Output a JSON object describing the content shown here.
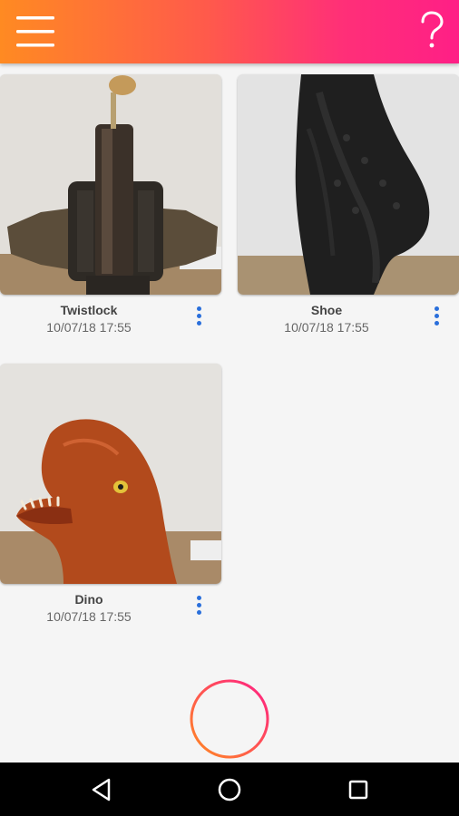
{
  "app": {
    "icons": {
      "menu": "hamburger-menu-icon",
      "help": "question-mark-icon",
      "add": "plus-icon",
      "more": "more-vertical-icon"
    },
    "colors": {
      "appbar_gradient_start": "#ff8a22",
      "appbar_gradient_end": "#ff1f86",
      "accent_blue": "#2a6fdb",
      "background": "#f5f5f5"
    }
  },
  "captures": [
    {
      "title": "Twistlock",
      "date": "10/07/18 17:55"
    },
    {
      "title": "Shoe",
      "date": "10/07/18 17:55"
    },
    {
      "title": "Dino",
      "date": "10/07/18 17:55"
    }
  ],
  "system_nav": {
    "back": "back-triangle-icon",
    "home": "home-circle-icon",
    "recents": "recents-square-icon"
  }
}
